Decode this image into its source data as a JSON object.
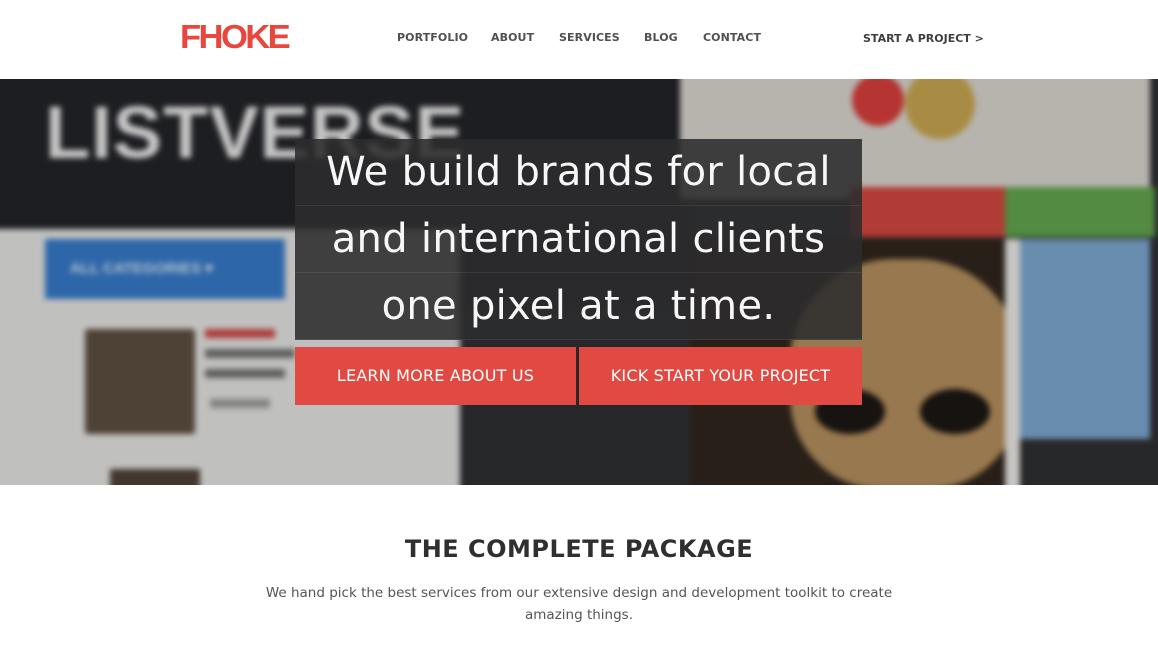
{
  "brand": {
    "logo_text": "FHOKE",
    "accent_color": "#e14a42"
  },
  "nav": {
    "items": [
      {
        "label": "PORTFOLIO"
      },
      {
        "label": "ABOUT"
      },
      {
        "label": "SERVICES"
      },
      {
        "label": "BLOG"
      },
      {
        "label": "CONTACT"
      }
    ],
    "cta_label": "START A PROJECT >"
  },
  "hero": {
    "background_text": "LISTVERSE",
    "background_category_text": "ALL CATEGORIES ▾",
    "headline_lines": [
      "We build brands for local",
      "and international clients",
      "one pixel at a time."
    ],
    "buttons": {
      "learn_more": "LEARN MORE ABOUT US",
      "kick_start": "KICK START YOUR PROJECT"
    }
  },
  "package": {
    "title": "THE COMPLETE PACKAGE",
    "description": "We hand pick the best services from our extensive design and development toolkit to create amazing things."
  }
}
